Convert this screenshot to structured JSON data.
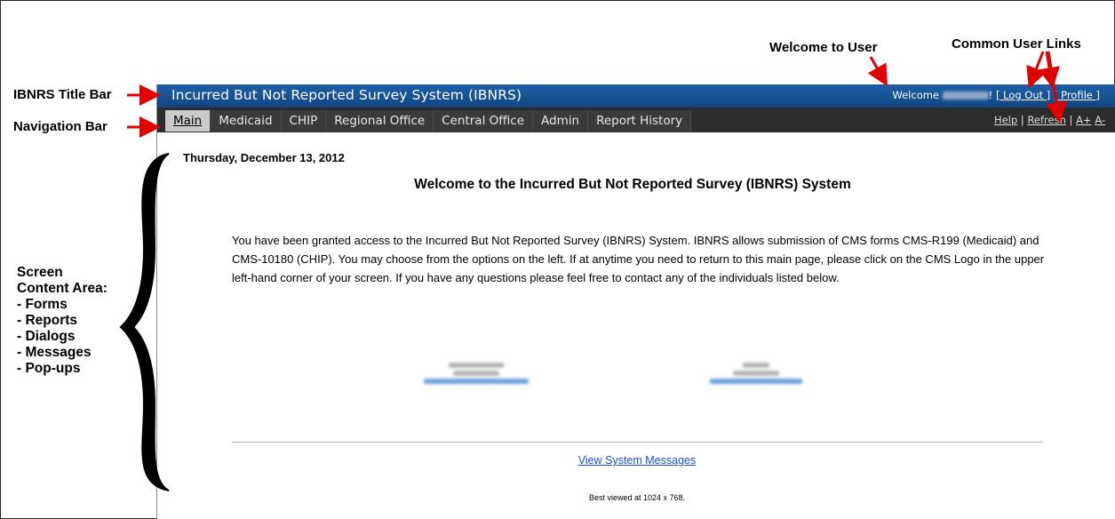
{
  "annotations": {
    "welcome_to_user": "Welcome to User",
    "common_user_links": "Common User Links",
    "title_bar": "IBNRS Title Bar",
    "navigation_bar": "Navigation Bar",
    "content_area": [
      "Screen",
      "Content Area:",
      " - Forms",
      " - Reports",
      " - Dialogs",
      " - Messages",
      " - Pop-ups"
    ]
  },
  "titlebar": {
    "title": "Incurred But Not Reported Survey System (IBNRS)",
    "welcome_label": "Welcome",
    "logout": "[ Log Out ]",
    "profile": "[ Profile ]",
    "bang": "!"
  },
  "navbar": {
    "tabs": [
      "Main",
      "Medicaid",
      "CHIP",
      "Regional Office",
      "Central Office",
      "Admin",
      "Report History"
    ],
    "active_tab": "Main",
    "help": "Help",
    "refresh": "Refresh",
    "sep": "|",
    "font_up": "A+",
    "font_down": "A-"
  },
  "content": {
    "date": "Thursday, December 13, 2012",
    "heading": "Welcome to the Incurred But Not Reported Survey (IBNRS) System",
    "intro": "You have been granted access to the Incurred But Not Reported Survey (IBNRS) System. IBNRS allows submission of CMS forms CMS-R199 (Medicaid) and CMS-10180 (CHIP). You may choose from the options on the left. If at anytime you need to return to this main page, please click on the CMS Logo in the upper left-hand corner of your screen. If you have any questions please feel free to contact any of the individuals listed below.",
    "view_messages": "View System Messages",
    "best_viewed": "Best viewed at 1024 x 768."
  },
  "colors": {
    "title_bar": "#11467f",
    "nav_bar": "#2c2c2c",
    "active_tab": "#c9c9c9",
    "link": "#1a4fd0",
    "arrow": "#e00000"
  }
}
